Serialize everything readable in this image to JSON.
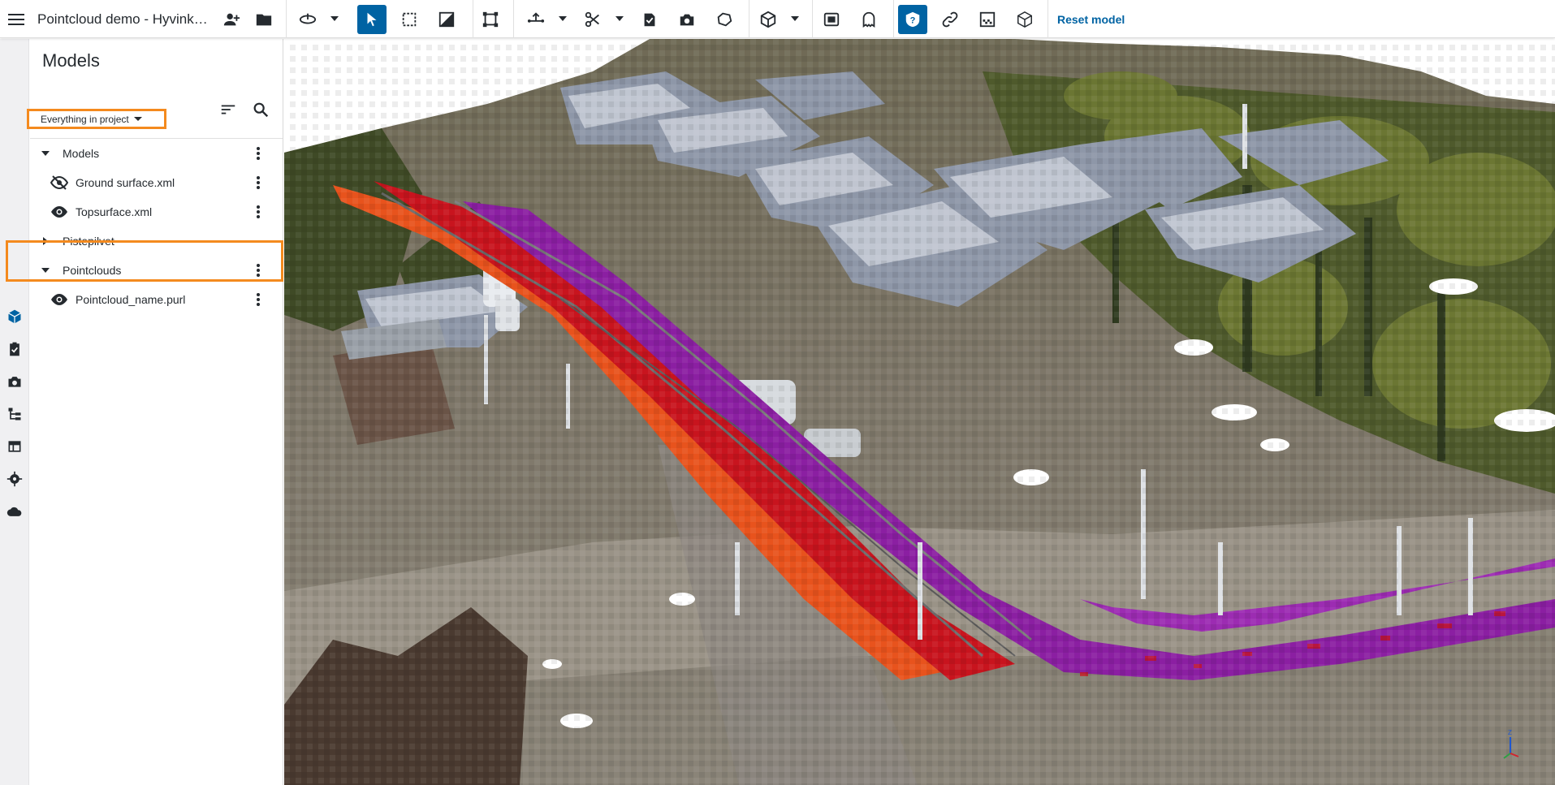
{
  "app": {
    "project_title": "Pointcloud demo - Hyvinkä...",
    "reset_label": "Reset model"
  },
  "panel": {
    "title": "Models",
    "filter_label": "Everything in project",
    "tree": [
      {
        "label": "Models",
        "kind": "group",
        "expanded": true,
        "has_menu": true
      },
      {
        "label": "Ground surface.xml",
        "kind": "item",
        "visibility": "hidden",
        "has_menu": true
      },
      {
        "label": "Topsurface.xml",
        "kind": "item",
        "visibility": "visible",
        "has_menu": true
      },
      {
        "label": "Pistepilvet",
        "kind": "group",
        "expanded": false,
        "has_menu": false
      },
      {
        "label": "Pointclouds",
        "kind": "group",
        "expanded": true,
        "has_menu": true
      },
      {
        "label": "Pointcloud_name.purl",
        "kind": "item",
        "visibility": "visible",
        "has_menu": true,
        "highlighted": true
      }
    ]
  },
  "toolbar": {
    "icons": [
      "orbit-icon",
      "select-pointer-icon",
      "box-select-icon",
      "section-plane-icon",
      "clip-box-icon",
      "measure-icon",
      "scissors-icon",
      "add-todo-icon",
      "snapshot-icon",
      "lasso-icon",
      "object-cube-icon",
      "screenshot-view-icon",
      "ghost-icon",
      "help-icon",
      "link-icon",
      "texture-icon",
      "model-box-icon"
    ],
    "active": [
      "select-pointer-icon",
      "help-icon"
    ]
  },
  "rail": {
    "icons": [
      "models-cube-icon",
      "todo-clipboard-icon",
      "camera-icon",
      "hierarchy-icon",
      "layout-table-icon",
      "settings-gear-icon",
      "cloud-icon"
    ],
    "active": "models-cube-icon"
  },
  "colors": {
    "accent_blue": "#0063a3",
    "highlight_orange": "#f48a1e",
    "road_purple": "#8b1fa2",
    "road_red": "#c8141e",
    "road_orange": "#e8531d"
  }
}
